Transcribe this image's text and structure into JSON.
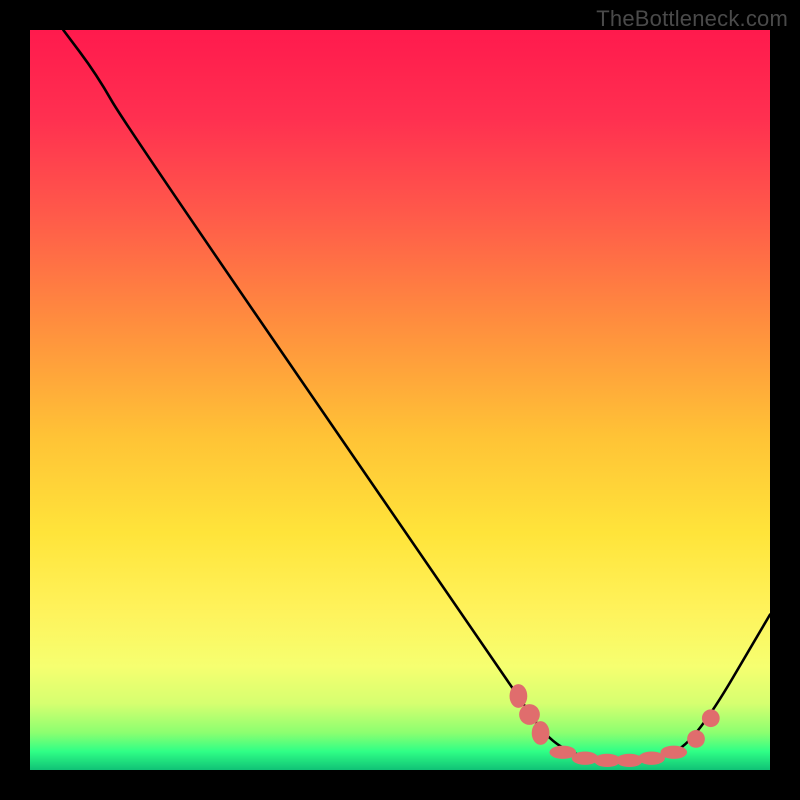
{
  "watermark": "TheBottleneck.com",
  "gradient_stops": [
    {
      "offset": 0.0,
      "color": "#ff1a4d"
    },
    {
      "offset": 0.12,
      "color": "#ff3050"
    },
    {
      "offset": 0.25,
      "color": "#ff5a4a"
    },
    {
      "offset": 0.4,
      "color": "#ff8f3e"
    },
    {
      "offset": 0.55,
      "color": "#ffc336"
    },
    {
      "offset": 0.68,
      "color": "#ffe43a"
    },
    {
      "offset": 0.78,
      "color": "#fff25a"
    },
    {
      "offset": 0.86,
      "color": "#f6ff70"
    },
    {
      "offset": 0.91,
      "color": "#d6ff70"
    },
    {
      "offset": 0.95,
      "color": "#8bff70"
    },
    {
      "offset": 0.975,
      "color": "#2fff86"
    },
    {
      "offset": 1.0,
      "color": "#10c176"
    }
  ],
  "chart_data": {
    "type": "line",
    "title": "",
    "xlabel": "",
    "ylabel": "",
    "xlim": [
      0,
      100
    ],
    "ylim": [
      0,
      100
    ],
    "series": [
      {
        "name": "curve",
        "points": [
          {
            "x": 4.5,
            "y": 100.0
          },
          {
            "x": 9.0,
            "y": 94.0
          },
          {
            "x": 13.0,
            "y": 87.0
          },
          {
            "x": 66.0,
            "y": 10.0
          },
          {
            "x": 70.0,
            "y": 4.0
          },
          {
            "x": 75.0,
            "y": 1.5
          },
          {
            "x": 80.0,
            "y": 1.0
          },
          {
            "x": 85.0,
            "y": 1.5
          },
          {
            "x": 90.0,
            "y": 4.0
          },
          {
            "x": 100.0,
            "y": 21.0
          }
        ]
      }
    ],
    "markers": [
      {
        "x": 66.0,
        "y": 10.0,
        "rx": 1.2,
        "ry": 1.6
      },
      {
        "x": 67.5,
        "y": 7.5,
        "rx": 1.4,
        "ry": 1.4
      },
      {
        "x": 69.0,
        "y": 5.0,
        "rx": 1.2,
        "ry": 1.6
      },
      {
        "x": 72.0,
        "y": 2.4,
        "rx": 1.8,
        "ry": 0.9
      },
      {
        "x": 75.0,
        "y": 1.6,
        "rx": 1.8,
        "ry": 0.9
      },
      {
        "x": 78.0,
        "y": 1.3,
        "rx": 1.8,
        "ry": 0.9
      },
      {
        "x": 81.0,
        "y": 1.3,
        "rx": 1.8,
        "ry": 0.9
      },
      {
        "x": 84.0,
        "y": 1.6,
        "rx": 1.8,
        "ry": 0.9
      },
      {
        "x": 87.0,
        "y": 2.4,
        "rx": 1.8,
        "ry": 0.9
      },
      {
        "x": 90.0,
        "y": 4.2,
        "rx": 1.2,
        "ry": 1.2
      },
      {
        "x": 92.0,
        "y": 7.0,
        "rx": 1.2,
        "ry": 1.2
      }
    ],
    "marker_color": "#e06d6d",
    "curve_color": "#000000"
  }
}
